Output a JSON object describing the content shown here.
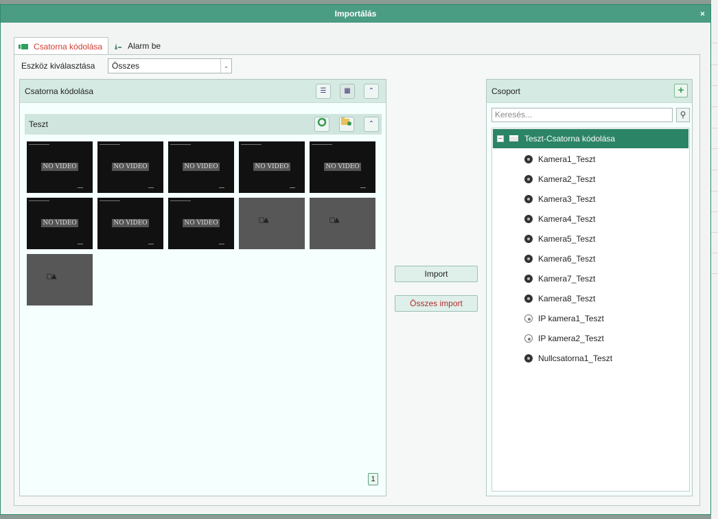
{
  "dialog": {
    "title": "Importálás",
    "close": "×"
  },
  "tabs": [
    {
      "label": "Csatorna kódolása",
      "icon": "camera-icon",
      "active": true
    },
    {
      "label": "Alarm be",
      "icon": "alarm-icon",
      "active": false
    }
  ],
  "device": {
    "label": "Eszköz kiválasztása",
    "selected": "Összes"
  },
  "left_panel": {
    "title": "Csatorna kódolása",
    "group": {
      "title": "Teszt"
    },
    "thumbnails": [
      {
        "text": "NO VIDEO",
        "state": "no-video"
      },
      {
        "text": "NO VIDEO",
        "state": "no-video"
      },
      {
        "text": "NO VIDEO",
        "state": "no-video"
      },
      {
        "text": "NO VIDEO",
        "state": "no-video"
      },
      {
        "text": "NO VIDEO",
        "state": "no-video"
      },
      {
        "text": "NO VIDEO",
        "state": "no-video"
      },
      {
        "text": "NO VIDEO",
        "state": "no-video"
      },
      {
        "text": "NO VIDEO",
        "state": "no-video"
      },
      {
        "state": "offline"
      },
      {
        "state": "offline"
      },
      {
        "state": "offline"
      }
    ],
    "page": "1"
  },
  "actions": {
    "import": "Import",
    "import_all": "Összes import"
  },
  "right_panel": {
    "title": "Csoport",
    "search_placeholder": "Keresés...",
    "tree": {
      "root": "Teszt-Csatorna kódolása",
      "items": [
        {
          "label": "Kamera1_Teszt",
          "type": "camera"
        },
        {
          "label": "Kamera2_Teszt",
          "type": "camera"
        },
        {
          "label": "Kamera3_Teszt",
          "type": "camera"
        },
        {
          "label": "Kamera4_Teszt",
          "type": "camera"
        },
        {
          "label": "Kamera5_Teszt",
          "type": "camera"
        },
        {
          "label": "Kamera6_Teszt",
          "type": "camera"
        },
        {
          "label": "Kamera7_Teszt",
          "type": "camera"
        },
        {
          "label": "Kamera8_Teszt",
          "type": "camera"
        },
        {
          "label": "IP kamera1_Teszt",
          "type": "ip-camera"
        },
        {
          "label": "IP kamera2_Teszt",
          "type": "ip-camera"
        },
        {
          "label": "Nullcsatorna1_Teszt",
          "type": "camera"
        }
      ]
    }
  },
  "colors": {
    "accent": "#4a9c82",
    "tree_selected": "#2c8466",
    "active_tab_text": "#d03b2f"
  }
}
